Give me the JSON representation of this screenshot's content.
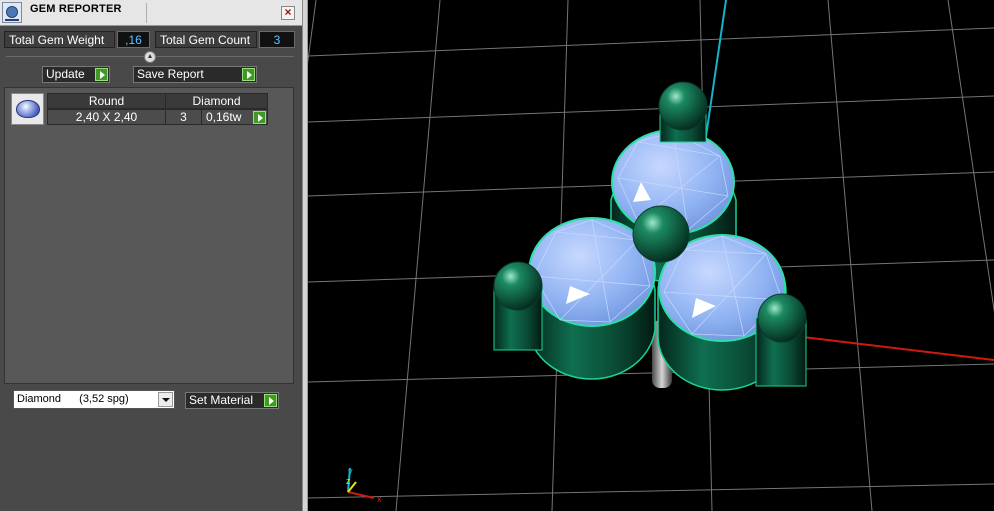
{
  "window": {
    "title": "GEM REPORTER",
    "close_glyph": "×",
    "app_icon": "gem-reporter-app-icon",
    "close_icon": "close-icon"
  },
  "totals": {
    "weight_label": "Total Gem Weight",
    "weight_value": ",16",
    "count_label": "Total Gem Count",
    "count_value": "3"
  },
  "actions": {
    "update_label": "Update",
    "save_label": "Save Report",
    "go_icon": "play-arrow-icon"
  },
  "gem_table": {
    "headers": [
      "Round",
      "Diamond"
    ],
    "rows": [
      {
        "size": "2,40 X 2,40",
        "count": "3",
        "weight": "0,16tw",
        "thumbnail": "round-gem-icon"
      }
    ]
  },
  "material": {
    "selected_name": "Diamond",
    "selected_density": "(3,52 spg)",
    "set_label": "Set Material"
  },
  "viewport": {
    "axis_labels": {
      "x": "x",
      "y": "y",
      "z": "z"
    },
    "colors": {
      "x_axis": "#d11a0e",
      "y_axis": "#14b3c6",
      "z_axis": "#e8e400",
      "grid": "#8a8a8a",
      "metal": "#0e6a4c",
      "gem": "#8fb2f2",
      "background": "#000000"
    }
  }
}
